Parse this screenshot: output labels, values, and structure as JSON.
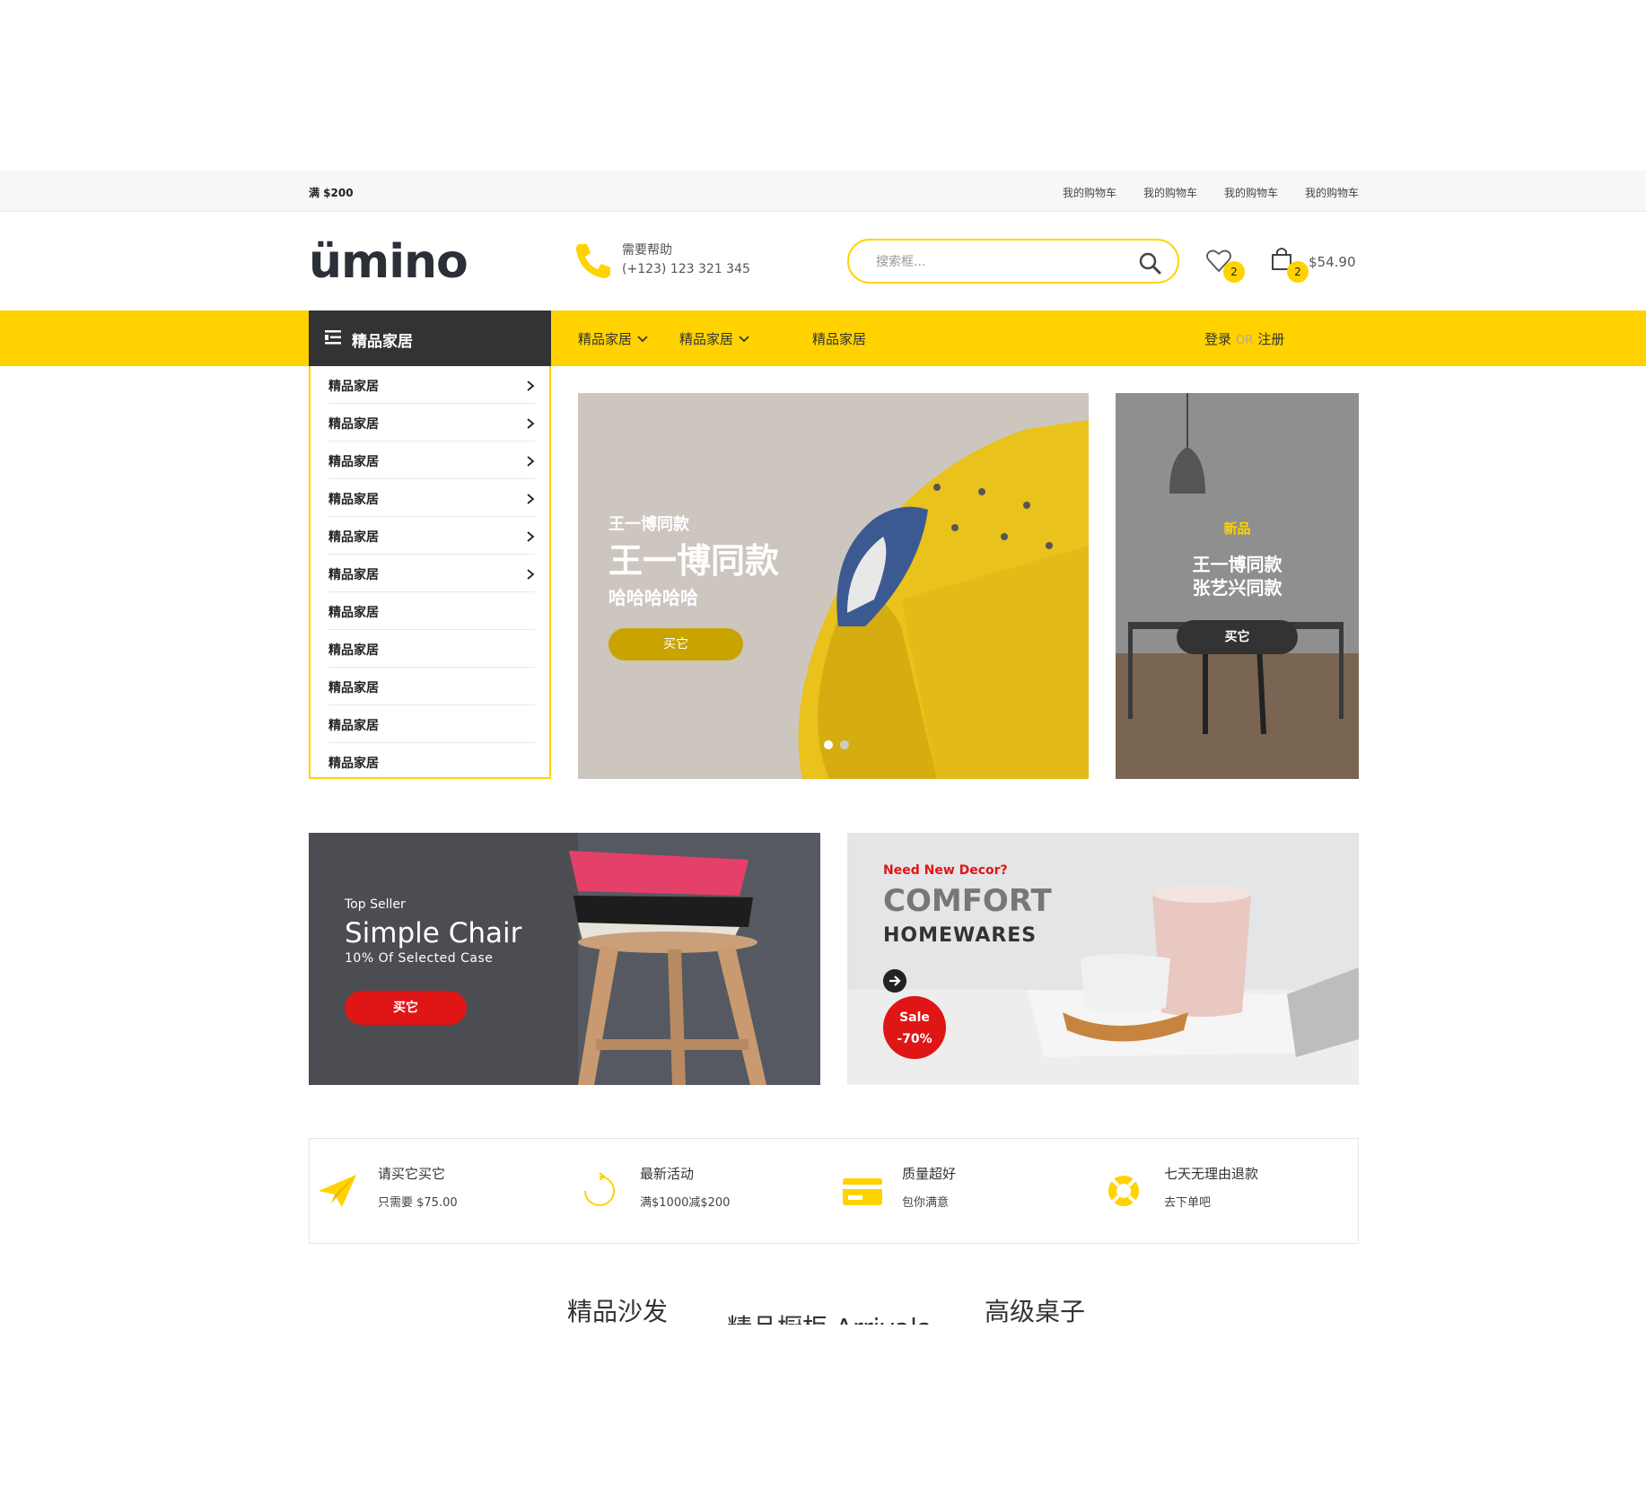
{
  "topbar": {
    "promo": "满 $200",
    "links": [
      "我的购物车",
      "我的购物车",
      "我的购物车",
      "我的购物车"
    ]
  },
  "header": {
    "logo": "ümino",
    "help_label": "需要帮助",
    "help_phone": "(+123) 123 321 345",
    "search_placeholder": "搜索框...",
    "wishlist_count": "2",
    "cart_count": "2",
    "cart_total": "$54.90"
  },
  "nav": {
    "category_title": "精品家居",
    "items": [
      "精品家居",
      "精品家居",
      "精品家居"
    ],
    "login": "登录",
    "or": "OR",
    "register": "注册"
  },
  "categories": [
    {
      "label": "精品家居",
      "has_arrow": true
    },
    {
      "label": "精品家居",
      "has_arrow": true
    },
    {
      "label": "精品家居",
      "has_arrow": true
    },
    {
      "label": "精品家居",
      "has_arrow": true
    },
    {
      "label": "精品家居",
      "has_arrow": true
    },
    {
      "label": "精品家居",
      "has_arrow": true
    },
    {
      "label": "精品家居",
      "has_arrow": false
    },
    {
      "label": "精品家居",
      "has_arrow": false
    },
    {
      "label": "精品家居",
      "has_arrow": false
    },
    {
      "label": "精品家居",
      "has_arrow": false
    },
    {
      "label": "精品家居",
      "has_arrow": false
    }
  ],
  "hero": {
    "small_title": "王一博同款",
    "big_title": "王一博同款",
    "subtitle": "哈哈哈哈哈",
    "button": "买它",
    "active_slide": 1,
    "slides": 2
  },
  "side_banner": {
    "tag": "新品",
    "title_line1": "王一博同款",
    "title_line2": "张艺兴同款",
    "button": "买它"
  },
  "promo_left": {
    "tag": "Top Seller",
    "title": "Simple Chair",
    "subtitle": "10% Of Selected Case",
    "button": "买它"
  },
  "promo_right": {
    "tag": "Need New Decor?",
    "title": "COMFORT",
    "subtitle": "HOMEWARES",
    "sale_label": "Sale",
    "sale_value": "-70%"
  },
  "features": [
    {
      "icon": "paper-plane-icon",
      "title": "请买它买它",
      "text": "只需要 $75.00"
    },
    {
      "icon": "refresh-icon",
      "title": "最新活动",
      "text": "满$1000减$200"
    },
    {
      "icon": "credit-card-icon",
      "title": "质量超好",
      "text": "包你满意"
    },
    {
      "icon": "lifebuoy-icon",
      "title": "七天无理由退款",
      "text": "去下单吧"
    }
  ],
  "tabs": [
    "精品沙发",
    "精品橱柜 Arrivals",
    "高级桌子"
  ],
  "colors": {
    "accent": "#ffd200",
    "dark": "#333333",
    "red": "#e01515"
  }
}
